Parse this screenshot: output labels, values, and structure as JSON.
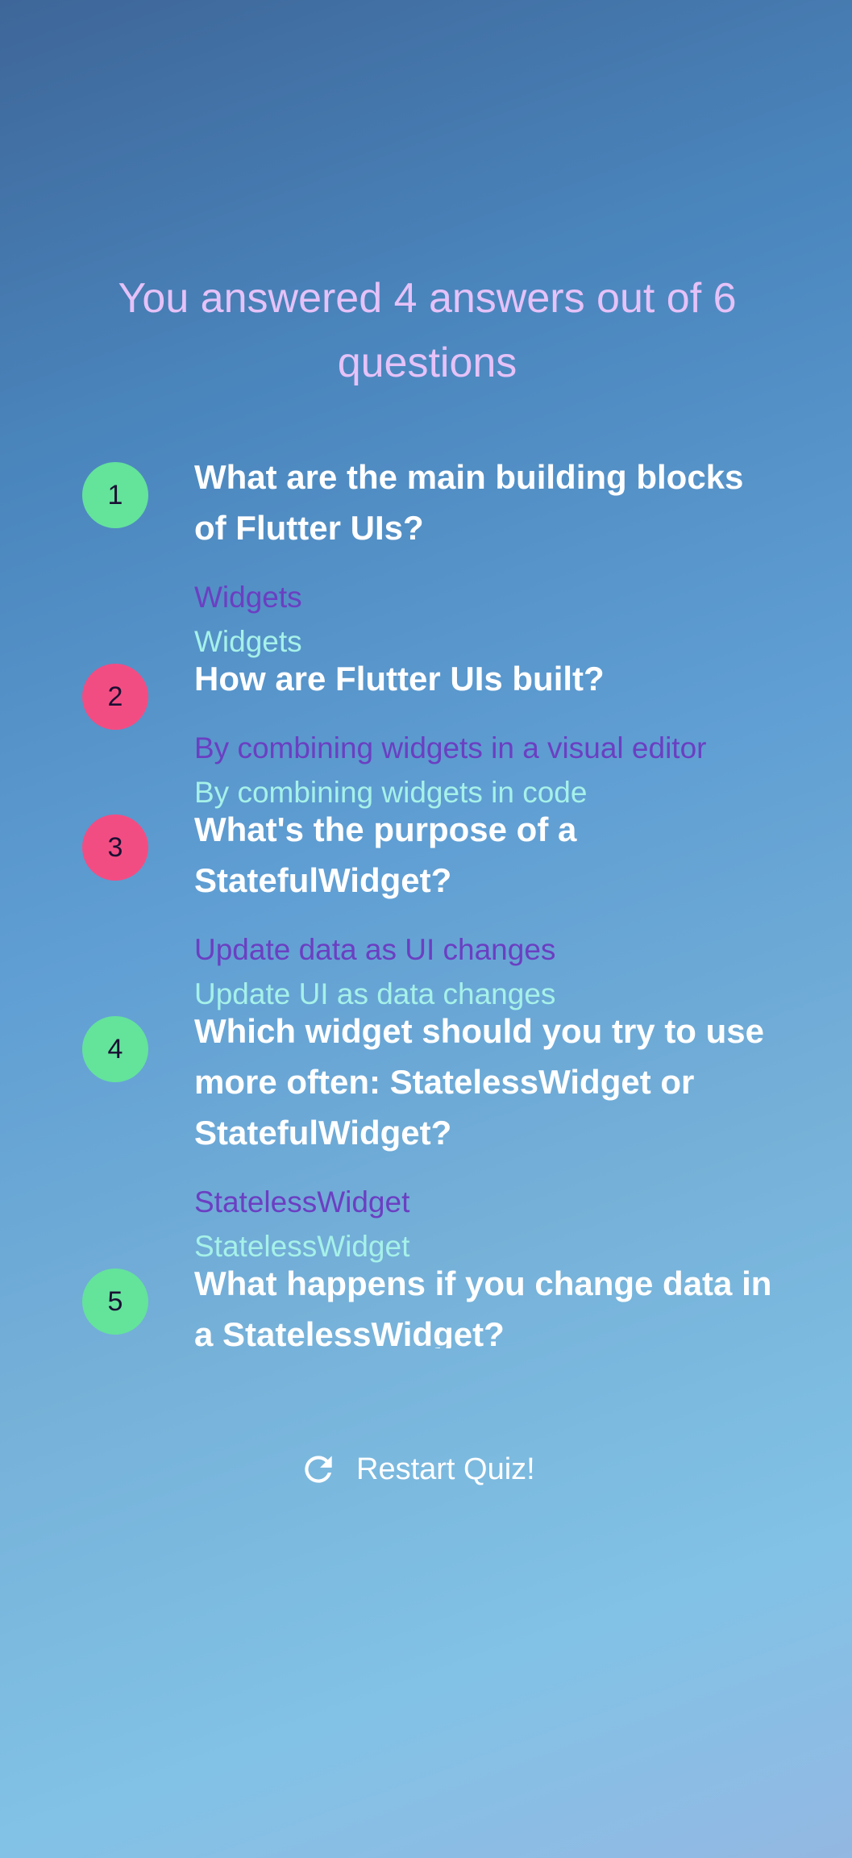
{
  "result_title": "You answered 4 answers out of 6 questions",
  "summary": [
    {
      "index": "1",
      "correct": true,
      "question": "What are the main building blocks of Flutter UIs?",
      "user_answer": "Widgets",
      "correct_answer": "Widgets"
    },
    {
      "index": "2",
      "correct": false,
      "question": "How are Flutter UIs built?",
      "user_answer": "By combining widgets in a visual editor",
      "correct_answer": "By combining widgets in code"
    },
    {
      "index": "3",
      "correct": false,
      "question": "What's the purpose of a StatefulWidget?",
      "user_answer": "Update data as UI changes",
      "correct_answer": "Update UI as data changes"
    },
    {
      "index": "4",
      "correct": true,
      "question": "Which widget should you try to use more often: StatelessWidget or StatefulWidget?",
      "user_answer": "StatelessWidget",
      "correct_answer": "StatelessWidget"
    },
    {
      "index": "5",
      "correct": true,
      "question": "What happens if you change data in a StatelessWidget?",
      "user_answer": "",
      "correct_answer": ""
    }
  ],
  "restart_button": {
    "label": "Restart Quiz!",
    "icon": "refresh-icon"
  },
  "colors": {
    "title": "#e5c2f8",
    "correct_badge": "#64e39b",
    "wrong_badge": "#f24d83",
    "user_answer": "#6b3fc2",
    "correct_answer": "#a6f1e9"
  }
}
